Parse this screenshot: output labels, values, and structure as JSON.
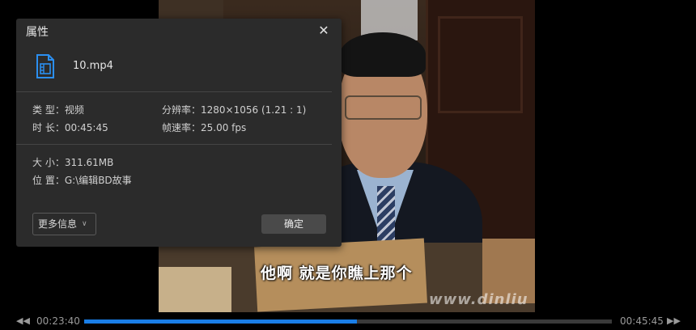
{
  "dialog": {
    "title": "属性",
    "file_name": "10.mp4",
    "properties": {
      "type": "类 型：视频",
      "duration": "时 长：00:45:45",
      "resolution": "分辨率：1280×1056 (1.21 : 1)",
      "framerate": "帧速率：25.00 fps",
      "size": "大 小：311.61MB",
      "location": "位 置：G:\\编辑BD故事"
    },
    "more_info_label": "更多信息",
    "ok_label": "确定"
  },
  "video": {
    "subtitle": "他啊 就是你瞧上那个",
    "watermark": "www.dinliu"
  },
  "player": {
    "current_time": "00:23:40",
    "total_time": "00:45:45",
    "progress_fraction": 0.517,
    "accent_color": "#1a7ee6"
  }
}
